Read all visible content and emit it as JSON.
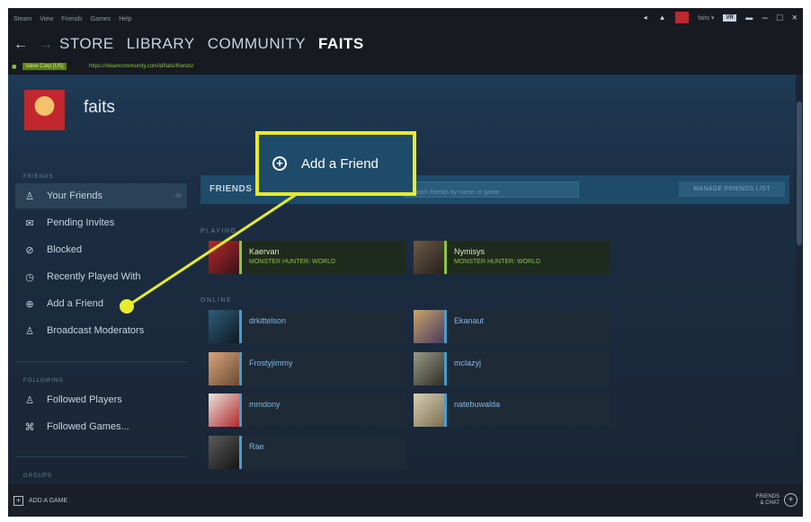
{
  "menubar": {
    "items": [
      "Steam",
      "View",
      "Friends",
      "Games",
      "Help"
    ],
    "account": "faits ▾",
    "vr": "VR"
  },
  "nav": {
    "tabs": [
      "STORE",
      "LIBRARY",
      "COMMUNITY",
      "FAITS"
    ],
    "active_tab": "FAITS"
  },
  "url": {
    "cert": "Valve Corp [US]",
    "address": "https://steamcommunity.com/id/faits/friends/"
  },
  "profile": {
    "name": "faits"
  },
  "sidebar": {
    "friends_label": "FRIENDS",
    "items": [
      {
        "label": "Your Friends",
        "icon": "person-icon",
        "count": "4k"
      },
      {
        "label": "Pending Invites",
        "icon": "envelope-icon"
      },
      {
        "label": "Blocked",
        "icon": "blocked-icon"
      },
      {
        "label": "Recently Played With",
        "icon": "clock-icon"
      },
      {
        "label": "Add a Friend",
        "icon": "plus-circle-icon"
      },
      {
        "label": "Broadcast Moderators",
        "icon": "person-icon"
      }
    ],
    "following_label": "FOLLOWING",
    "following_items": [
      {
        "label": "Followed Players",
        "icon": "person-plus-icon"
      },
      {
        "label": "Followed Games...",
        "icon": "gamepad-icon"
      }
    ],
    "groups_label": "GROUPS"
  },
  "friends_bar": {
    "header": "FRIENDS",
    "search_placeholder": "Search friends by name or game",
    "manage_label": "MANAGE FRIENDS LIST"
  },
  "playing_label": "PLAYING",
  "playing": [
    {
      "name": "Kaervan",
      "game": "MONSTER HUNTER: WORLD"
    },
    {
      "name": "Nymisys",
      "game": "MONSTER HUNTER: WORLD"
    }
  ],
  "online_label": "ONLINE",
  "online": [
    {
      "name": "drkittelson"
    },
    {
      "name": "Ekanaut"
    },
    {
      "name": "Frostyjimmy"
    },
    {
      "name": "mclazyj"
    },
    {
      "name": "mmdony"
    },
    {
      "name": "natebuwalda"
    },
    {
      "name": "Rae"
    }
  ],
  "bottom": {
    "add_game": "ADD A GAME",
    "friends_chat_1": "FRIENDS",
    "friends_chat_2": "& CHAT"
  },
  "callout": {
    "label": "Add a Friend"
  },
  "colors": {
    "highlight": "#e7eb2c",
    "accent": "#1e4b6a",
    "in_game": "#8bc53f"
  }
}
